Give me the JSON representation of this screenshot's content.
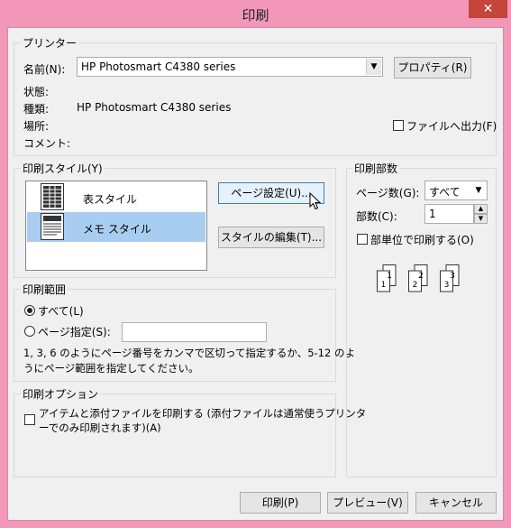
{
  "window": {
    "title": "印刷",
    "close_glyph": "✕"
  },
  "printer": {
    "group_label": "プリンター",
    "name_label": "名前(N):",
    "name_value": "HP Photosmart C4380 series",
    "properties_button": "プロパティ(R)",
    "status_label": "状態:",
    "status_value": "",
    "type_label": "種類:",
    "type_value": "HP Photosmart C4380 series",
    "location_label": "場所:",
    "comment_label": "コメント:",
    "print_to_file": "ファイルへ出力(F)"
  },
  "print_style": {
    "group_label": "印刷スタイル(Y)",
    "styles": [
      {
        "label": "表スタイル",
        "icon": "table-style-icon",
        "selected": false
      },
      {
        "label": "メモ スタイル",
        "icon": "memo-style-icon",
        "selected": true
      }
    ],
    "page_setup_button": "ページ設定(U)...",
    "edit_styles_button": "スタイルの編集(T)..."
  },
  "print_range": {
    "group_label": "印刷範囲",
    "all_label": "すべて(L)",
    "pages_label": "ページ指定(S):",
    "pages_value": "",
    "help_line1": "1, 3, 6 のようにページ番号をカンマで区切って指定するか、5-12 のよ",
    "help_line2": "うにページ範囲を指定してください。"
  },
  "print_options": {
    "group_label": "印刷オプション",
    "attachments_line1": "アイテムと添付ファイルを印刷する (添付ファイルは通常使うプリンタ",
    "attachments_line2": "ーでのみ印刷されます)(A)"
  },
  "copies": {
    "group_label": "印刷部数",
    "pages_label": "ページ数(G):",
    "pages_value": "すべて",
    "count_label": "部数(C):",
    "count_value": "1",
    "collate_label": "部単位で印刷する(O)",
    "collate_pages": [
      "1",
      "1",
      "2",
      "2",
      "3",
      "3"
    ]
  },
  "footer": {
    "print_button": "印刷(P)",
    "preview_button": "プレビュー(V)",
    "cancel_button": "キャンセル"
  },
  "colors": {
    "titlebar": "#f297b8",
    "selected": "#a9cdf0",
    "close": "#c5453a"
  }
}
